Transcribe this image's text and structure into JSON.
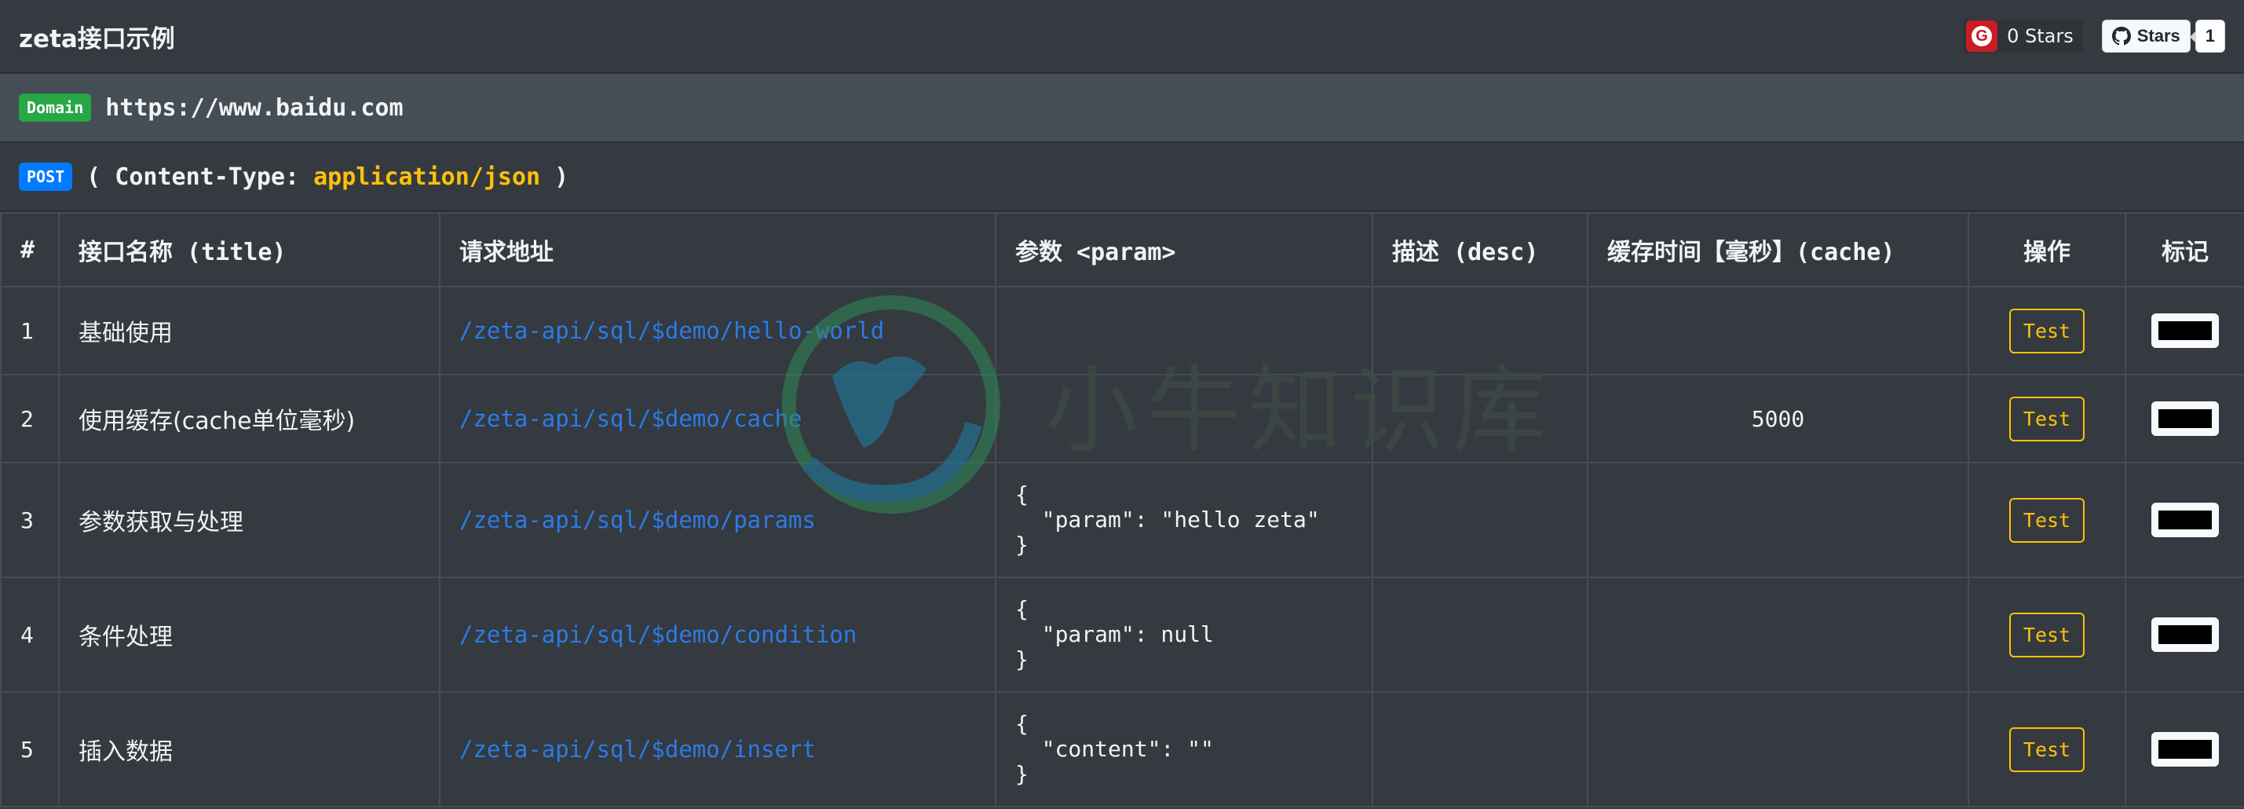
{
  "header": {
    "title": "zeta接口示例",
    "gitee_stars": "0 Stars",
    "github_label": "Stars",
    "github_count": "1"
  },
  "domain": {
    "badge": "Domain",
    "url": "https://www.baidu.com"
  },
  "request": {
    "method_badge": "POST",
    "open": "( Content-Type:",
    "content_type": "application/json",
    "close": ")"
  },
  "table": {
    "headers": [
      "#",
      "接口名称 (title)",
      "请求地址",
      "参数 <param>",
      "描述 (desc)",
      "缓存时间【毫秒】(cache)",
      "操作",
      "标记"
    ],
    "rows": [
      {
        "idx": "1",
        "title": "基础使用",
        "url": "/zeta-api/sql/$demo/hello-world",
        "param": "",
        "desc": "",
        "cache": "",
        "action": "Test"
      },
      {
        "idx": "2",
        "title": "使用缓存(cache单位毫秒)",
        "url": "/zeta-api/sql/$demo/cache",
        "param": "",
        "desc": "",
        "cache": "5000",
        "action": "Test"
      },
      {
        "idx": "3",
        "title": "参数获取与处理",
        "url": "/zeta-api/sql/$demo/params",
        "param": "{\n  \"param\": \"hello zeta\"\n}",
        "desc": "",
        "cache": "",
        "action": "Test"
      },
      {
        "idx": "4",
        "title": "条件处理",
        "url": "/zeta-api/sql/$demo/condition",
        "param": "{\n  \"param\": null\n}",
        "desc": "",
        "cache": "",
        "action": "Test"
      },
      {
        "idx": "5",
        "title": "插入数据",
        "url": "/zeta-api/sql/$demo/insert",
        "param": "{\n  \"content\": \"\"\n}",
        "desc": "",
        "cache": "",
        "action": "Test"
      }
    ]
  },
  "watermark": {
    "text": "小牛知识库"
  },
  "colors": {
    "background": "#343a40",
    "accent": "#ffc107",
    "link": "#2c7be5",
    "domain_badge": "#28a745",
    "method_badge": "#007bff"
  }
}
